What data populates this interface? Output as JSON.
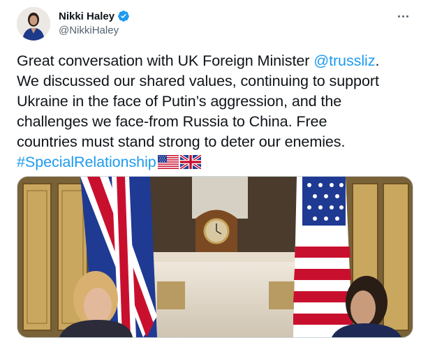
{
  "author": {
    "display_name": "Nikki Haley",
    "handle": "@NikkiHaley",
    "verified": true
  },
  "tweet": {
    "line1_text": "Great conversation with UK Foreign Minister ",
    "mention": "@trussliz",
    "line1_end": ".",
    "line2": "We discussed our shared values, continuing to support",
    "line3": "Ukraine in the face of Putin’s aggression, and the",
    "line4": "challenges we face-from Russia to China. Free",
    "line5": "countries must stand strong to deter our enemies.",
    "hashtag": "#SpecialRelationship",
    "emojis": [
      "us-flag",
      "uk-flag"
    ]
  },
  "colors": {
    "link": "#1d9bf0",
    "text": "#0f1419",
    "secondary": "#536471",
    "verified": "#1d9bf0"
  },
  "icons": {
    "verified": "verified-badge-icon",
    "more": "more-options-icon"
  }
}
